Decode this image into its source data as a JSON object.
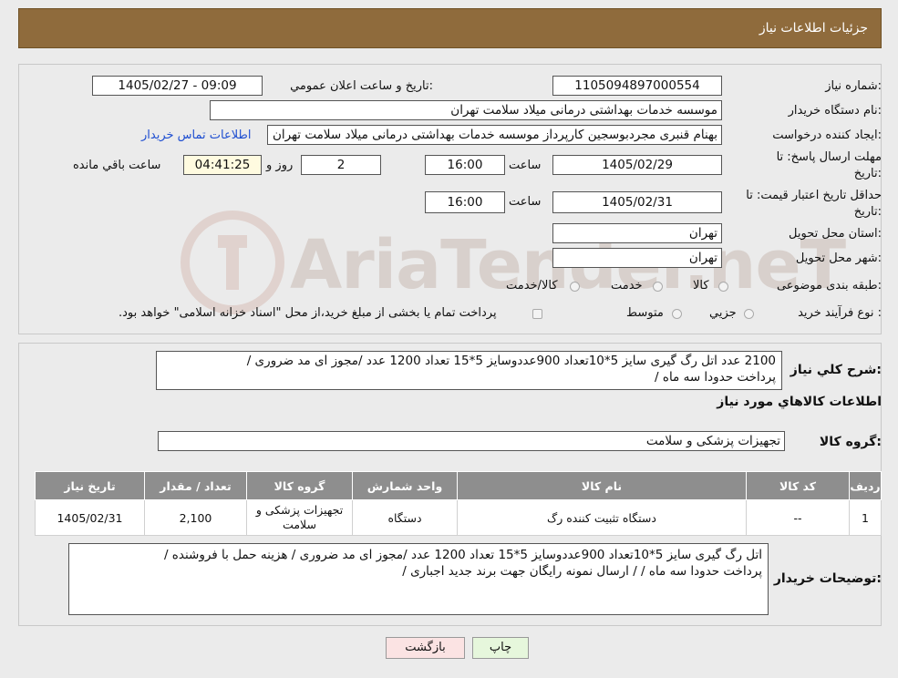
{
  "header": {
    "title": "جزئیات اطلاعات نیاز"
  },
  "watermark": {
    "text": "AriaTender.neT"
  },
  "form": {
    "need_number": {
      "label": "شماره نیاز:",
      "value": "1105094897000554"
    },
    "announce_datetime": {
      "label": "تاریخ و ساعت اعلان عمومي:",
      "value": "1405/02/27 - 09:09"
    },
    "buyer_org": {
      "label": "نام دستگاه خريدار:",
      "value": "موسسه خدمات بهداشتی درمانی میلاد سلامت تهران"
    },
    "requester": {
      "label": "ايجاد کننده درخواست:",
      "value": "بهنام قنبری مجردبوسجین کارپرداز موسسه خدمات بهداشتی درمانی میلاد سلامت تهران",
      "contact_link": "اطلاعات تماس خريدار"
    },
    "reply_deadline": {
      "label_line1": "مهلت ارسال پاسخ: تا",
      "label_line2": "تاريخ:",
      "date": "1405/02/29",
      "time_label": "ساعت",
      "time": "16:00",
      "days": "2",
      "days_label": "روز و",
      "remaining": "04:41:25",
      "remaining_label": "ساعت باقي مانده"
    },
    "price_validity": {
      "label_line1": "حداقل تاريخ اعتبار قيمت: تا",
      "label_line2": "تاريخ:",
      "date": "1405/02/31",
      "time_label": "ساعت",
      "time": "16:00"
    },
    "delivery_province": {
      "label": "استان محل تحويل:",
      "value": "تهران"
    },
    "delivery_city": {
      "label": "شهر محل تحويل:",
      "value": "تهران"
    },
    "category": {
      "label": "طبقه بندی موضوعی:",
      "options": [
        "کالا",
        "خدمت",
        "کالا/خدمت"
      ]
    },
    "purchase_process": {
      "label": "نوع فرآيند خريد :",
      "options": [
        "جزيي",
        "متوسط"
      ],
      "note": "پرداخت تمام يا بخشی از مبلغ خريد،از محل \"اسناد خزانه اسلامی\" خواهد بود."
    }
  },
  "summary": {
    "label": "شرح کلي نياز:",
    "line1": "2100 عدد اتل رگ گیری سایز   5*10تعداد 900عددوسایز 5*15 تعداد 1200 عدد     /مجوز ای مد ضروری /",
    "line2": "پرداخت حدودا سه ماه  /"
  },
  "goods_info_title": "اطلاعات کالاهاي مورد نياز",
  "goods_group": {
    "label": "گروه کالا:",
    "value": "تجهیزات پزشکی و سلامت"
  },
  "table": {
    "headers": [
      "رديف",
      "کد کالا",
      "نام کالا",
      "واحد شمارش",
      "گروه کالا",
      "تعداد / مقدار",
      "تاريخ نياز"
    ],
    "rows": [
      {
        "row": "1",
        "code": "--",
        "name": "دستگاه تثبیت کننده رگ",
        "unit": "دستگاه",
        "group_line1": "تجهیزات پزشکی و",
        "group_line2": "سلامت",
        "qty": "2,100",
        "date": "1405/02/31"
      }
    ]
  },
  "buyer_notes": {
    "label": "توضيحات خريدار:",
    "line1": "اتل رگ گیری سایز   5*10تعداد 900عددوسایز 5*15 تعداد 1200 عدد     /مجوز ای مد ضروری / هزینه حمل با فروشنده /",
    "line2": "پرداخت حدودا سه ماه  /  / ارسال نمونه رایگان جهت برند جدید اجباری /"
  },
  "buttons": {
    "print": "چاپ",
    "back": "بازگشت"
  }
}
